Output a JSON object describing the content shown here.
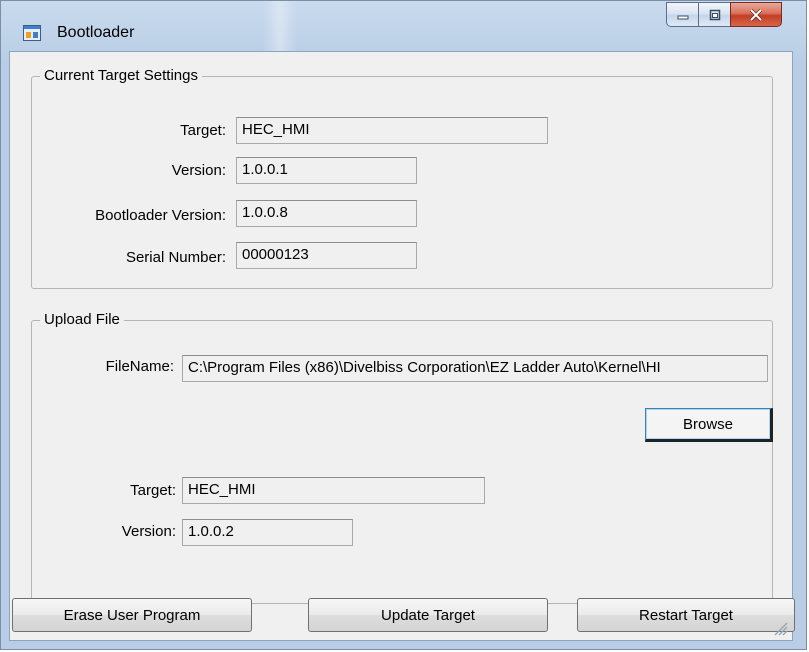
{
  "window": {
    "title": "Bootloader",
    "colors": {
      "titlebar": "#b9cee6",
      "client": "#f0f0f0",
      "close_button": "#c33e22"
    }
  },
  "current_settings": {
    "group_title": "Current Target Settings",
    "target_label": "Target:",
    "target_value": "HEC_HMI",
    "version_label": "Version:",
    "version_value": "1.0.0.1",
    "bootloader_version_label": "Bootloader Version:",
    "bootloader_version_value": "1.0.0.8",
    "serial_label": "Serial Number:",
    "serial_value": "00000123"
  },
  "upload_file": {
    "group_title": "Upload File",
    "filename_label": "FileName:",
    "filename_value": "C:\\Program Files (x86)\\Divelbiss Corporation\\EZ Ladder Auto\\Kernel\\HI",
    "browse_label": "Browse",
    "target_label": "Target:",
    "target_value": "HEC_HMI",
    "version_label": "Version:",
    "version_value": "1.0.0.2"
  },
  "buttons": {
    "erase_label": "Erase User Program",
    "update_label": "Update Target",
    "restart_label": "Restart Target"
  },
  "icons": {
    "app": "app-window-icon",
    "minimize": "minimize-icon",
    "maximize": "maximize-icon",
    "close": "close-icon",
    "grip": "resize-grip-icon"
  }
}
